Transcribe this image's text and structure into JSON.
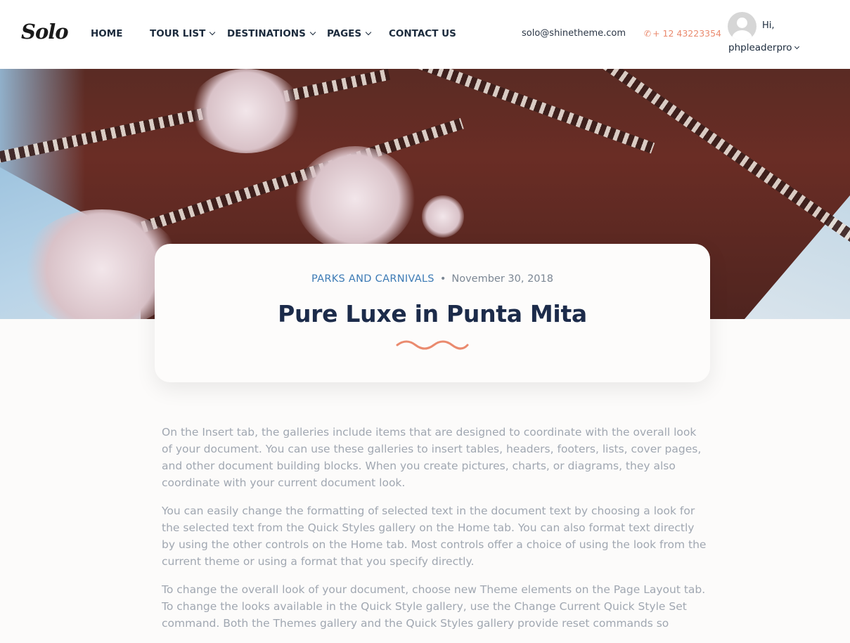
{
  "brand": {
    "logo_text": "Solo"
  },
  "nav": {
    "items": [
      {
        "label": "HOME",
        "has_dropdown": false
      },
      {
        "label": "TOUR LIST",
        "has_dropdown": true
      },
      {
        "label": "DESTINATIONS",
        "has_dropdown": true
      },
      {
        "label": "PAGES",
        "has_dropdown": true
      },
      {
        "label": "CONTACT US",
        "has_dropdown": false
      }
    ]
  },
  "contact": {
    "email": "solo@shinetheme.com",
    "phone": "+ 12 43223354",
    "phone_icon": "phone-icon"
  },
  "user": {
    "greeting": "Hi,",
    "username": "phpleaderpro",
    "avatar_icon": "avatar-placeholder-icon"
  },
  "post": {
    "category": "PARKS AND CARNIVALS",
    "separator": "•",
    "date": "November 30, 2018",
    "title": "Pure Luxe in Punta Mita",
    "paragraphs": [
      "On the Insert tab, the galleries include items that are designed to coordinate with the overall look of your document. You can use these galleries to insert tables, headers, footers, lists, cover pages, and other document building blocks. When you create pictures, charts, or diagrams, they also coordinate with your current document look.",
      "You can easily change the formatting of selected text in the document text by choosing a look for the selected text from the Quick Styles gallery on the Home tab. You can also format text directly by using the other controls on the Home tab. Most controls offer a choice of using the look from the current theme or using a format that you specify directly.",
      "To change the overall look of your document, choose new Theme elements on the Page Layout tab. To change the looks available in the Quick Style gallery, use the Change Current Quick Style Set command. Both the Themes gallery and the Quick Styles gallery provide reset commands so"
    ]
  },
  "colors": {
    "accent": "#ea8a6e",
    "link": "#3d7bb5",
    "heading": "#1c2b4a",
    "body_text": "#a0a7b1"
  }
}
